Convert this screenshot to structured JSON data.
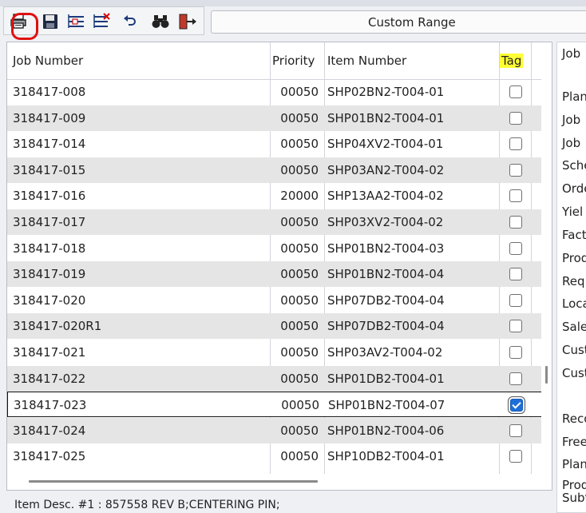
{
  "toolbar": {
    "buttons": [
      {
        "name": "print",
        "icon": "printer-icon"
      },
      {
        "name": "save",
        "icon": "floppy-disk-icon"
      },
      {
        "name": "expand",
        "icon": "tree-expand-icon"
      },
      {
        "name": "collapse",
        "icon": "tree-collapse-icon"
      },
      {
        "name": "undo",
        "icon": "undo-arrow-icon"
      },
      {
        "name": "find",
        "icon": "binoculars-icon"
      },
      {
        "name": "exit",
        "icon": "exit-door-icon"
      }
    ],
    "highlight_color": "#e01010"
  },
  "range": {
    "label": "Custom Range"
  },
  "grid": {
    "headers": {
      "job": "Job Number",
      "priority": "Priority",
      "item": "Item Number",
      "tag": "Tag"
    },
    "tag_highlight_color": "#ffff33",
    "rows": [
      {
        "job": "318417-008",
        "priority": "00050",
        "item": "SHP02BN2-T004-01",
        "tagged": false
      },
      {
        "job": "318417-009",
        "priority": "00050",
        "item": "SHP01BN2-T004-01",
        "tagged": false
      },
      {
        "job": "318417-014",
        "priority": "00050",
        "item": "SHP04XV2-T004-01",
        "tagged": false
      },
      {
        "job": "318417-015",
        "priority": "00050",
        "item": "SHP03AN2-T004-02",
        "tagged": false
      },
      {
        "job": "318417-016",
        "priority": "20000",
        "item": "SHP13AA2-T004-02",
        "tagged": false
      },
      {
        "job": "318417-017",
        "priority": "00050",
        "item": "SHP03XV2-T004-02",
        "tagged": false
      },
      {
        "job": "318417-018",
        "priority": "00050",
        "item": "SHP01BN2-T004-03",
        "tagged": false
      },
      {
        "job": "318417-019",
        "priority": "00050",
        "item": "SHP01BN2-T004-04",
        "tagged": false
      },
      {
        "job": "318417-020",
        "priority": "00050",
        "item": "SHP07DB2-T004-04",
        "tagged": false
      },
      {
        "job": "318417-020R1",
        "priority": "00050",
        "item": "SHP07DB2-T004-04",
        "tagged": false
      },
      {
        "job": "318417-021",
        "priority": "00050",
        "item": "SHP03AV2-T004-02",
        "tagged": false
      },
      {
        "job": "318417-022",
        "priority": "00050",
        "item": "SHP01DB2-T004-01",
        "tagged": false
      },
      {
        "job": "318417-023",
        "priority": "00050",
        "item": "SHP01BN2-T004-07",
        "tagged": true
      },
      {
        "job": "318417-024",
        "priority": "00050",
        "item": "SHP01BN2-T004-06",
        "tagged": false
      },
      {
        "job": "318417-025",
        "priority": "00050",
        "item": "SHP10DB2-T004-01",
        "tagged": false
      }
    ],
    "selected_row": 12
  },
  "details": {
    "labels": [
      "Job",
      "Plan",
      "Job",
      "Job",
      "Sche",
      "Orde",
      "Yiel",
      "Fact",
      "Prod",
      "Req",
      "Loca",
      "Sale",
      "Cust",
      "Cust",
      "Reco",
      "Free",
      "Plan",
      "Prod",
      "Subt"
    ]
  },
  "footer": {
    "item_desc": "Item Desc. #1 :  857558 REV B;CENTERING PIN;"
  }
}
